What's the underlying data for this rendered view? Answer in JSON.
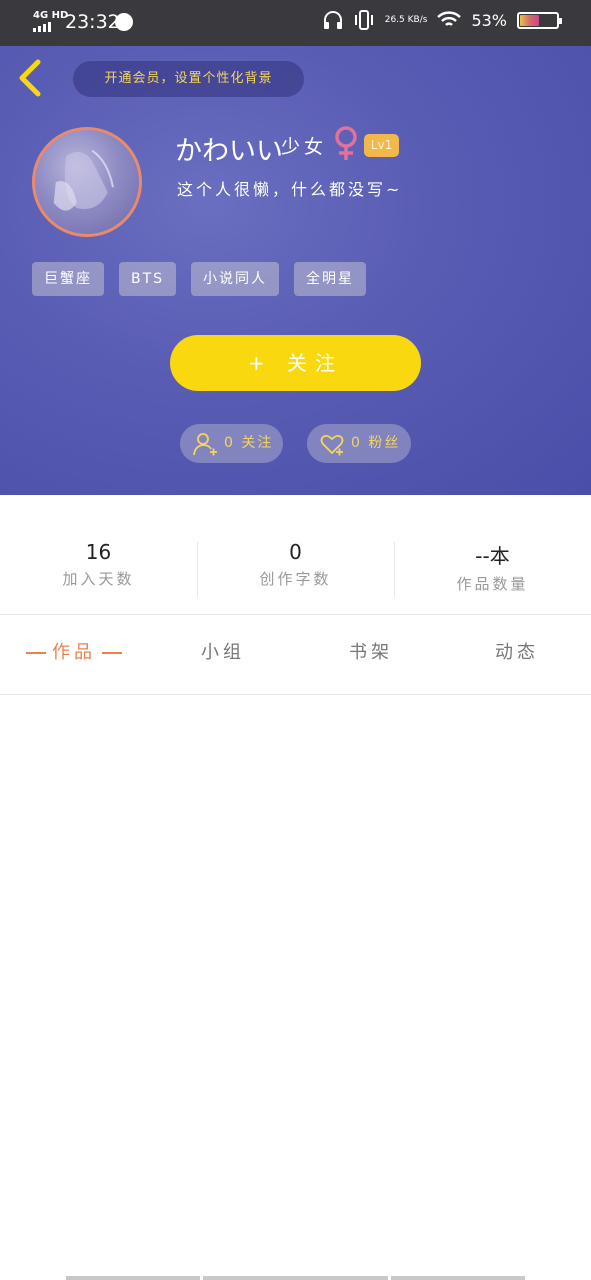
{
  "status_bar": {
    "network": "4G HD",
    "time": "23:32",
    "speed": "26.5 KB/s",
    "battery": "53%",
    "battery_level": 0.53
  },
  "header": {
    "vip_prompt": "开通会员，设置个性化背景",
    "nickname": "かわいい",
    "nickname_suffix": "少女",
    "gender": "female",
    "level": "Lv1",
    "signature": "这个人很懒，什么都没写~",
    "tags": [
      "巨蟹座",
      "BTS",
      "小说同人",
      "全明星"
    ],
    "follow_button": "+ 关注",
    "following": "0 关注",
    "fans": "0 粉丝"
  },
  "stats": [
    {
      "value": "16",
      "label": "加入天数"
    },
    {
      "value": "0",
      "label": "创作字数"
    },
    {
      "value": "--本",
      "label": "作品数量"
    }
  ],
  "tabs": [
    {
      "label": "作品",
      "active": true
    },
    {
      "label": "小组",
      "active": false
    },
    {
      "label": "书架",
      "active": false
    },
    {
      "label": "动态",
      "active": false
    }
  ],
  "colors": {
    "header_bg": "#5a5db4",
    "accent_yellow": "#f9d80f",
    "active_tab": "#e9824f",
    "level_badge": "#f2b84a",
    "gender_icon": "#e0739a"
  }
}
